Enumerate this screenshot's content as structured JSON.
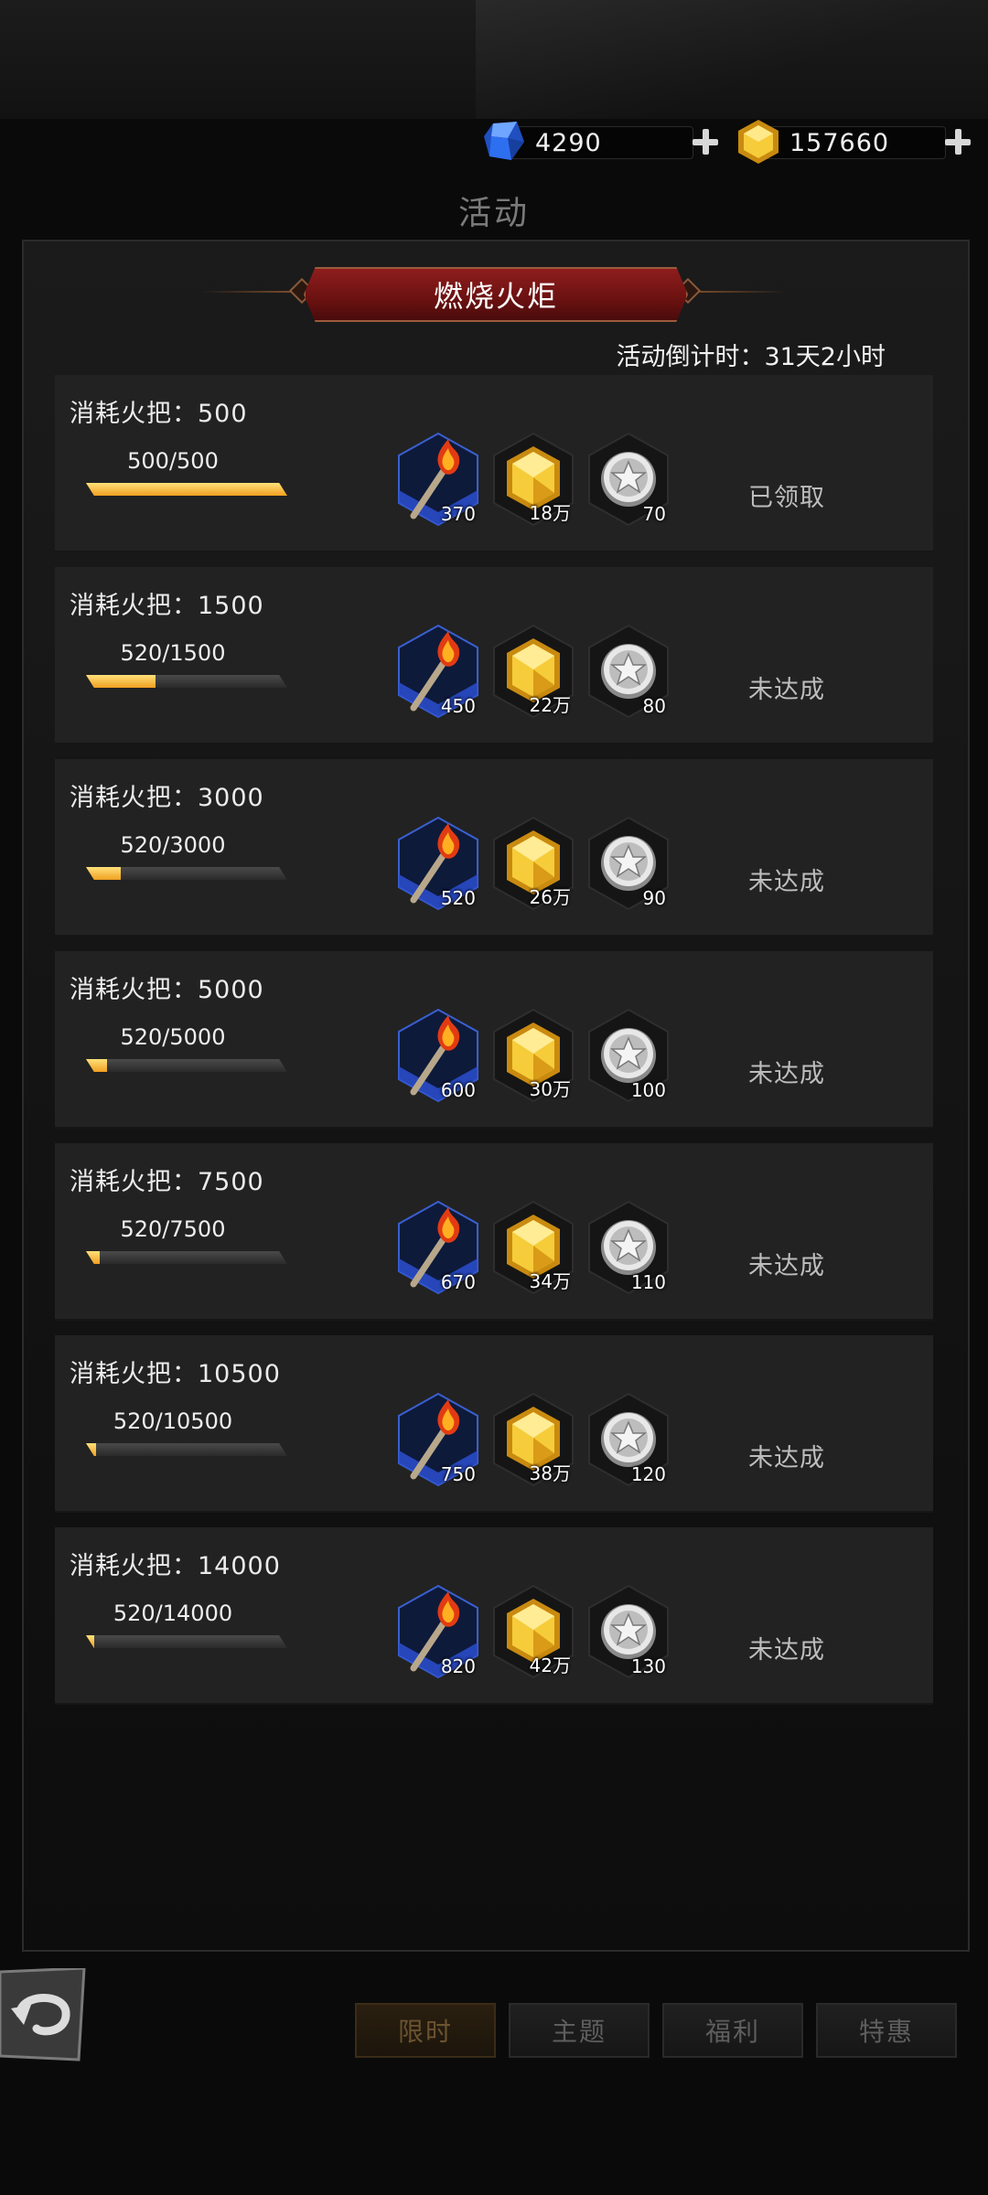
{
  "currency": {
    "gems": "4290",
    "gold": "157660"
  },
  "page_title": "活动",
  "event": {
    "banner": "燃烧火炬",
    "countdown": "活动倒计时：31天2小时"
  },
  "rows": [
    {
      "title": "消耗火把：500",
      "progress_text": "500/500",
      "progress": 1.0,
      "rewards": [
        "370",
        "18万",
        "70"
      ],
      "status": "已领取"
    },
    {
      "title": "消耗火把：1500",
      "progress_text": "520/1500",
      "progress": 0.347,
      "rewards": [
        "450",
        "22万",
        "80"
      ],
      "status": "未达成"
    },
    {
      "title": "消耗火把：3000",
      "progress_text": "520/3000",
      "progress": 0.173,
      "rewards": [
        "520",
        "26万",
        "90"
      ],
      "status": "未达成"
    },
    {
      "title": "消耗火把：5000",
      "progress_text": "520/5000",
      "progress": 0.104,
      "rewards": [
        "600",
        "30万",
        "100"
      ],
      "status": "未达成"
    },
    {
      "title": "消耗火把：7500",
      "progress_text": "520/7500",
      "progress": 0.069,
      "rewards": [
        "670",
        "34万",
        "110"
      ],
      "status": "未达成"
    },
    {
      "title": "消耗火把：10500",
      "progress_text": "520/10500",
      "progress": 0.05,
      "rewards": [
        "750",
        "38万",
        "120"
      ],
      "status": "未达成"
    },
    {
      "title": "消耗火把：14000",
      "progress_text": "520/14000",
      "progress": 0.037,
      "rewards": [
        "820",
        "42万",
        "130"
      ],
      "status": "未达成"
    }
  ],
  "reward_icons": [
    "torch-icon",
    "gold-gem-icon",
    "silver-coin-icon"
  ],
  "tabs": [
    "限时",
    "主题",
    "福利",
    "特惠"
  ],
  "active_tab": 0,
  "colors": {
    "banner_red": "#8e1d1d",
    "progress_gold": "#f0a020",
    "gem_blue": "#2e6ff0",
    "gold": "#f2c230"
  }
}
